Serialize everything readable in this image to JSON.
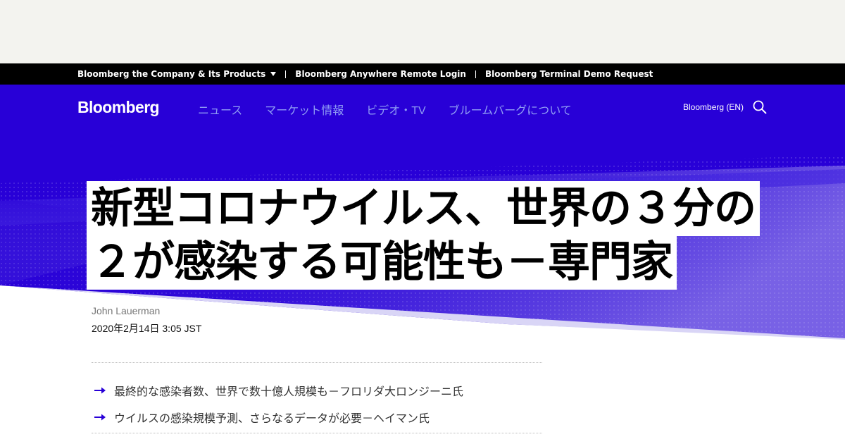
{
  "topbar": {
    "items": [
      "Bloomberg the Company & Its Products",
      "Bloomberg Anywhere Remote Login",
      "Bloomberg Terminal Demo Request"
    ]
  },
  "nav": {
    "logo": "Bloomberg",
    "links": [
      "ニュース",
      "マーケット情報",
      "ビデオ・TV",
      "ブルームバーグについて"
    ],
    "edition": "Bloomberg (EN)"
  },
  "article": {
    "headline": "新型コロナウイルス、世界の３分の２が感染する可能性も－専門家",
    "author": "John Lauerman",
    "date": "2020年2月14日 3:05 JST",
    "highlights": [
      "最終的な感染者数、世界で数十億人規模も－フロリダ大ロンジーニ氏",
      "ウイルスの感染規模予測、さらなるデータが必要－ヘイマン氏"
    ]
  },
  "colors": {
    "hero_blue": "#2800d7",
    "nav_link": "#8f9cf4",
    "arrow": "#2800d7"
  }
}
